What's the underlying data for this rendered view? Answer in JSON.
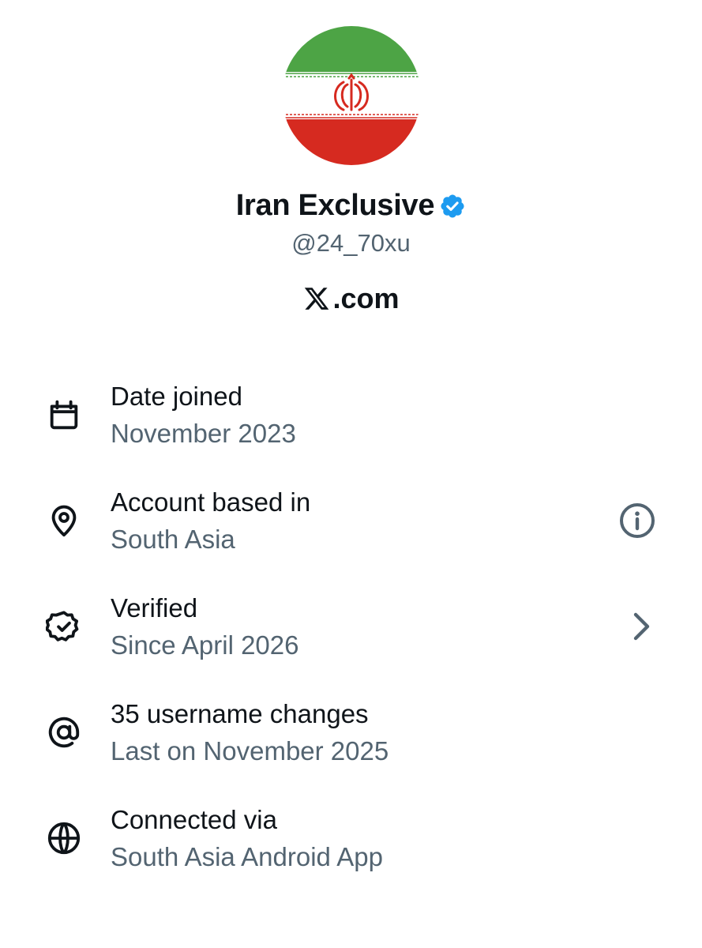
{
  "profile": {
    "display_name": "Iran Exclusive",
    "handle": "@24_70xu",
    "verified_badge_icon": "verified-check-icon",
    "badge_color": "#1d9bf0"
  },
  "site": {
    "logo_icon": "x-logo-icon",
    "text": ".com"
  },
  "rows": [
    {
      "icon": "calendar-icon",
      "title": "Date joined",
      "subtitle": "November 2023"
    },
    {
      "icon": "location-pin-icon",
      "title": "Account based in",
      "subtitle": "South Asia",
      "trailing_icon": "info-icon"
    },
    {
      "icon": "verified-badge-icon",
      "title": "Verified",
      "subtitle": "Since April 2026",
      "trailing_icon": "chevron-right-icon"
    },
    {
      "icon": "at-sign-icon",
      "title": "35 username changes",
      "subtitle": "Last on November 2025"
    },
    {
      "icon": "globe-icon",
      "title": "Connected via",
      "subtitle": "South Asia Android App"
    }
  ],
  "colors": {
    "primary_text": "#0f1419",
    "secondary_text": "#536471",
    "flag_green": "#4da445",
    "flag_red": "#d62a20"
  }
}
